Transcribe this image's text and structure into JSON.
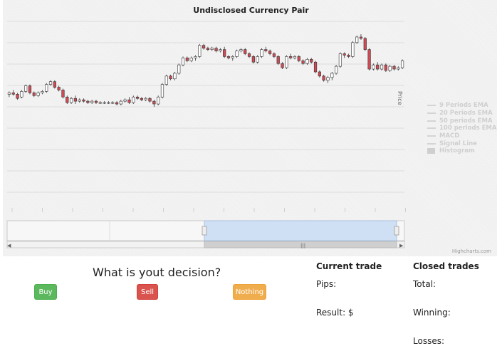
{
  "chart": {
    "title": "Undisclosed Currency Pair",
    "y_axis_title": "Price",
    "credits": "Highcharts.com",
    "legend": [
      {
        "label": "9 Periods EMA",
        "kind": "line"
      },
      {
        "label": "20 Periods EMA",
        "kind": "line"
      },
      {
        "label": "50 periods EMA",
        "kind": "line"
      },
      {
        "label": "100 periods EMA",
        "kind": "line"
      },
      {
        "label": "MACD",
        "kind": "line"
      },
      {
        "label": "Signal Line",
        "kind": "line"
      },
      {
        "label": "Histogram",
        "kind": "box"
      }
    ]
  },
  "chart_data": {
    "type": "candlestick",
    "title": "Undisclosed Currency Pair",
    "ylabel": "Price",
    "ylim": [
      0,
      100
    ],
    "colors": {
      "up": "#ffffff",
      "down": "#d24a55",
      "outline": "#333333",
      "navigator": "#cfe0f4"
    },
    "candles": [
      {
        "o": 58,
        "h": 60,
        "l": 56,
        "c": 59
      },
      {
        "o": 59,
        "h": 61,
        "l": 57,
        "c": 58
      },
      {
        "o": 58,
        "h": 59,
        "l": 54,
        "c": 55
      },
      {
        "o": 56,
        "h": 61,
        "l": 55,
        "c": 60
      },
      {
        "o": 60,
        "h": 65,
        "l": 59,
        "c": 64
      },
      {
        "o": 64,
        "h": 65,
        "l": 58,
        "c": 59
      },
      {
        "o": 59,
        "h": 60,
        "l": 56,
        "c": 57
      },
      {
        "o": 57,
        "h": 60,
        "l": 56,
        "c": 59
      },
      {
        "o": 59,
        "h": 61,
        "l": 58,
        "c": 60
      },
      {
        "o": 60,
        "h": 66,
        "l": 59,
        "c": 65
      },
      {
        "o": 65,
        "h": 68,
        "l": 64,
        "c": 67
      },
      {
        "o": 67,
        "h": 68,
        "l": 62,
        "c": 63
      },
      {
        "o": 63,
        "h": 64,
        "l": 60,
        "c": 61
      },
      {
        "o": 61,
        "h": 62,
        "l": 55,
        "c": 56
      },
      {
        "o": 56,
        "h": 57,
        "l": 51,
        "c": 52
      },
      {
        "o": 52,
        "h": 56,
        "l": 51,
        "c": 55
      },
      {
        "o": 55,
        "h": 57,
        "l": 51,
        "c": 53
      },
      {
        "o": 53,
        "h": 55,
        "l": 52,
        "c": 54
      },
      {
        "o": 54,
        "h": 55,
        "l": 52,
        "c": 53
      },
      {
        "o": 53,
        "h": 54,
        "l": 51,
        "c": 52
      },
      {
        "o": 52,
        "h": 54,
        "l": 51,
        "c": 53
      },
      {
        "o": 53,
        "h": 54,
        "l": 51,
        "c": 52
      },
      {
        "o": 52,
        "h": 53,
        "l": 51,
        "c": 52
      },
      {
        "o": 52,
        "h": 53,
        "l": 51,
        "c": 52
      },
      {
        "o": 52,
        "h": 53,
        "l": 51,
        "c": 52
      },
      {
        "o": 52,
        "h": 53,
        "l": 51,
        "c": 52
      },
      {
        "o": 52,
        "h": 53,
        "l": 50,
        "c": 51
      },
      {
        "o": 51,
        "h": 54,
        "l": 50,
        "c": 53
      },
      {
        "o": 53,
        "h": 55,
        "l": 52,
        "c": 54
      },
      {
        "o": 54,
        "h": 56,
        "l": 51,
        "c": 52
      },
      {
        "o": 52,
        "h": 57,
        "l": 51,
        "c": 56
      },
      {
        "o": 56,
        "h": 57,
        "l": 54,
        "c": 55
      },
      {
        "o": 55,
        "h": 56,
        "l": 53,
        "c": 54
      },
      {
        "o": 54,
        "h": 56,
        "l": 53,
        "c": 55
      },
      {
        "o": 55,
        "h": 56,
        "l": 52,
        "c": 53
      },
      {
        "o": 53,
        "h": 54,
        "l": 49,
        "c": 51
      },
      {
        "o": 51,
        "h": 57,
        "l": 50,
        "c": 56
      },
      {
        "o": 56,
        "h": 66,
        "l": 55,
        "c": 65
      },
      {
        "o": 65,
        "h": 72,
        "l": 64,
        "c": 71
      },
      {
        "o": 71,
        "h": 72,
        "l": 68,
        "c": 69
      },
      {
        "o": 69,
        "h": 74,
        "l": 68,
        "c": 73
      },
      {
        "o": 73,
        "h": 80,
        "l": 72,
        "c": 79
      },
      {
        "o": 79,
        "h": 85,
        "l": 78,
        "c": 84
      },
      {
        "o": 84,
        "h": 85,
        "l": 81,
        "c": 82
      },
      {
        "o": 82,
        "h": 85,
        "l": 81,
        "c": 84
      },
      {
        "o": 84,
        "h": 86,
        "l": 82,
        "c": 85
      },
      {
        "o": 85,
        "h": 94,
        "l": 84,
        "c": 93
      },
      {
        "o": 93,
        "h": 94,
        "l": 90,
        "c": 91
      },
      {
        "o": 91,
        "h": 92,
        "l": 89,
        "c": 90
      },
      {
        "o": 90,
        "h": 92,
        "l": 89,
        "c": 91
      },
      {
        "o": 91,
        "h": 92,
        "l": 88,
        "c": 89
      },
      {
        "o": 89,
        "h": 91,
        "l": 88,
        "c": 90
      },
      {
        "o": 90,
        "h": 92,
        "l": 84,
        "c": 85
      },
      {
        "o": 85,
        "h": 86,
        "l": 83,
        "c": 84
      },
      {
        "o": 84,
        "h": 86,
        "l": 82,
        "c": 85
      },
      {
        "o": 85,
        "h": 90,
        "l": 84,
        "c": 89
      },
      {
        "o": 89,
        "h": 91,
        "l": 88,
        "c": 90
      },
      {
        "o": 90,
        "h": 91,
        "l": 86,
        "c": 87
      },
      {
        "o": 87,
        "h": 88,
        "l": 84,
        "c": 85
      },
      {
        "o": 85,
        "h": 86,
        "l": 80,
        "c": 81
      },
      {
        "o": 81,
        "h": 86,
        "l": 80,
        "c": 85
      },
      {
        "o": 85,
        "h": 91,
        "l": 84,
        "c": 90
      },
      {
        "o": 90,
        "h": 92,
        "l": 88,
        "c": 89
      },
      {
        "o": 89,
        "h": 90,
        "l": 86,
        "c": 87
      },
      {
        "o": 87,
        "h": 88,
        "l": 84,
        "c": 85
      },
      {
        "o": 85,
        "h": 86,
        "l": 79,
        "c": 80
      },
      {
        "o": 80,
        "h": 81,
        "l": 76,
        "c": 77
      },
      {
        "o": 77,
        "h": 86,
        "l": 76,
        "c": 85
      },
      {
        "o": 85,
        "h": 87,
        "l": 83,
        "c": 84
      },
      {
        "o": 84,
        "h": 86,
        "l": 83,
        "c": 85
      },
      {
        "o": 85,
        "h": 86,
        "l": 81,
        "c": 82
      },
      {
        "o": 82,
        "h": 83,
        "l": 79,
        "c": 80
      },
      {
        "o": 80,
        "h": 84,
        "l": 79,
        "c": 83
      },
      {
        "o": 83,
        "h": 84,
        "l": 80,
        "c": 81
      },
      {
        "o": 81,
        "h": 82,
        "l": 73,
        "c": 74
      },
      {
        "o": 74,
        "h": 75,
        "l": 70,
        "c": 71
      },
      {
        "o": 71,
        "h": 72,
        "l": 67,
        "c": 68
      },
      {
        "o": 68,
        "h": 71,
        "l": 66,
        "c": 70
      },
      {
        "o": 70,
        "h": 74,
        "l": 68,
        "c": 73
      },
      {
        "o": 73,
        "h": 79,
        "l": 72,
        "c": 78
      },
      {
        "o": 78,
        "h": 88,
        "l": 77,
        "c": 87
      },
      {
        "o": 87,
        "h": 88,
        "l": 84,
        "c": 86
      },
      {
        "o": 86,
        "h": 87,
        "l": 84,
        "c": 85
      },
      {
        "o": 85,
        "h": 96,
        "l": 84,
        "c": 95
      },
      {
        "o": 95,
        "h": 100,
        "l": 94,
        "c": 99
      },
      {
        "o": 99,
        "h": 101,
        "l": 97,
        "c": 98
      },
      {
        "o": 98,
        "h": 99,
        "l": 89,
        "c": 90
      },
      {
        "o": 90,
        "h": 91,
        "l": 75,
        "c": 76
      },
      {
        "o": 76,
        "h": 80,
        "l": 75,
        "c": 79
      },
      {
        "o": 79,
        "h": 81,
        "l": 75,
        "c": 76
      },
      {
        "o": 76,
        "h": 80,
        "l": 75,
        "c": 79
      },
      {
        "o": 79,
        "h": 80,
        "l": 74,
        "c": 75
      },
      {
        "o": 75,
        "h": 79,
        "l": 74,
        "c": 78
      },
      {
        "o": 78,
        "h": 79,
        "l": 75,
        "c": 76
      },
      {
        "o": 76,
        "h": 78,
        "l": 75,
        "c": 77
      },
      {
        "o": 77,
        "h": 83,
        "l": 76,
        "c": 82
      }
    ]
  },
  "decision": {
    "question": "What is yout decision?",
    "buy_label": "Buy",
    "sell_label": "Sell",
    "nothing_label": "Nothing"
  },
  "current_trade": {
    "heading": "Current trade",
    "pips_label": "Pips:",
    "result_label": "Result: $"
  },
  "closed_trades": {
    "heading": "Closed trades",
    "total_label": "Total:",
    "winning_label": "Winning:",
    "losses_label": "Losses:"
  }
}
